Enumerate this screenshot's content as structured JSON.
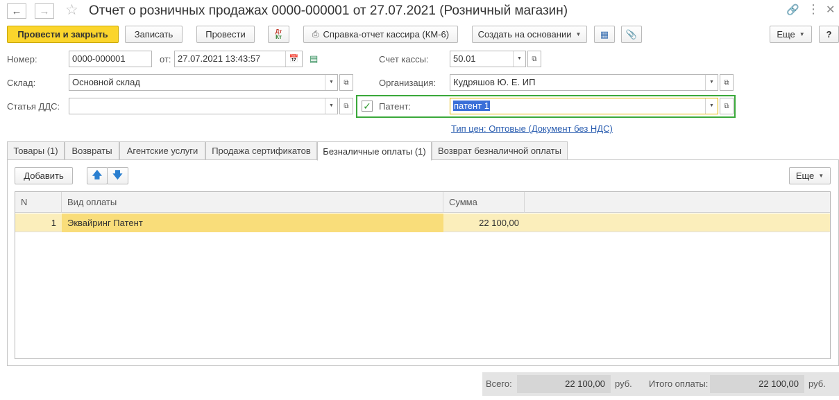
{
  "window": {
    "title": "Отчет о розничных продажах 0000-000001 от 27.07.2021 (Розничный магазин)"
  },
  "toolbar": {
    "post_close": "Провести и закрыть",
    "save": "Записать",
    "post": "Провести",
    "dtkt": "Дт Кт",
    "cashier_report": "Справка-отчет кассира (КМ-6)",
    "create_based": "Создать на основании",
    "more": "Еще",
    "help": "?"
  },
  "form": {
    "number_label": "Номер:",
    "number_value": "0000-000001",
    "date_label": "от:",
    "date_value": "27.07.2021 13:43:57",
    "warehouse_label": "Склад:",
    "warehouse_value": "Основной склад",
    "dds_label": "Статья ДДС:",
    "dds_value": "",
    "cash_account_label": "Счет кассы:",
    "cash_account_value": "50.01",
    "org_label": "Организация:",
    "org_value": "Кудряшов Ю. Е. ИП",
    "patent_label": "Патент:",
    "patent_value": "патент 1",
    "patent_checked": true,
    "price_type_link": "Тип цен: Оптовые (Документ без НДС)"
  },
  "tabs": [
    {
      "label": "Товары (1)",
      "active": false
    },
    {
      "label": "Возвраты",
      "active": false
    },
    {
      "label": "Агентские услуги",
      "active": false
    },
    {
      "label": "Продажа сертификатов",
      "active": false
    },
    {
      "label": "Безналичные оплаты (1)",
      "active": true
    },
    {
      "label": "Возврат безналичной оплаты",
      "active": false
    }
  ],
  "table_toolbar": {
    "add": "Добавить",
    "more": "Еще"
  },
  "table": {
    "columns": [
      "N",
      "Вид оплаты",
      "Сумма"
    ],
    "rows": [
      {
        "n": "1",
        "payment_type": "Эквайринг Патент",
        "amount": "22 100,00"
      }
    ]
  },
  "footer": {
    "total_label": "Всего:",
    "total_value": "22 100,00",
    "total_currency": "руб.",
    "payment_total_label": "Итого оплаты:",
    "payment_total_value": "22 100,00",
    "payment_total_currency": "руб."
  },
  "colors": {
    "primary_button": "#fbd52c",
    "patent_highlight": "#3aa83a",
    "selected_row": "#fbeebb",
    "link": "#2a5db0"
  }
}
